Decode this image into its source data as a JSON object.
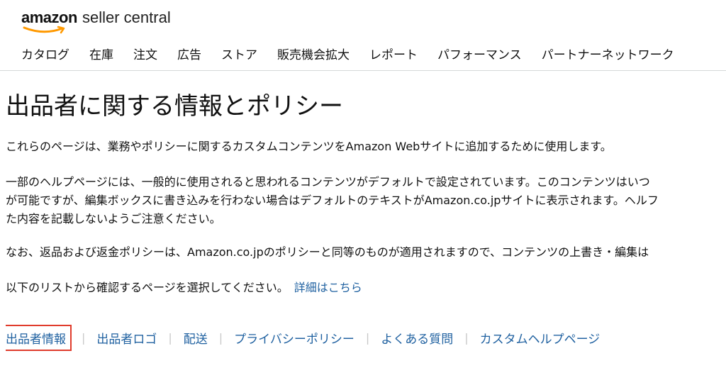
{
  "header": {
    "logo_brand": "amazon",
    "logo_product": "seller central",
    "nav": [
      "カタログ",
      "在庫",
      "注文",
      "広告",
      "ストア",
      "販売機会拡大",
      "レポート",
      "パフォーマンス",
      "パートナーネットワーク"
    ]
  },
  "main": {
    "title": "出品者に関する情報とポリシー",
    "paragraphs": {
      "p1": "これらのページは、業務やポリシーに関するカスタムコンテンツをAmazon Webサイトに追加するために使用します。",
      "p2_line1": "一部のヘルプページには、一般的に使用されると思われるコンテンツがデフォルトで設定されています。このコンテンツはいつ",
      "p2_line2": "が可能ですが、編集ボックスに書き込みを行わない場合はデフォルトのテキストがAmazon.co.jpサイトに表示されます。ヘルフ",
      "p2_line3": "た内容を記載しないようご注意ください。",
      "p3": "なお、返品および返金ポリシーは、Amazon.co.jpのポリシーと同等のものが適用されますので、コンテンツの上書き・編集は",
      "p4": "以下のリストから確認するページを選択してください。"
    },
    "details_link": "詳細はこちら",
    "tabs": [
      "出品者情報",
      "出品者ロゴ",
      "配送",
      "プライバシーポリシー",
      "よくある質問",
      "カスタムヘルプページ"
    ]
  },
  "colors": {
    "link": "#2162a1",
    "selected_outline": "#e03c2c",
    "logo_smile": "#ff9900"
  }
}
